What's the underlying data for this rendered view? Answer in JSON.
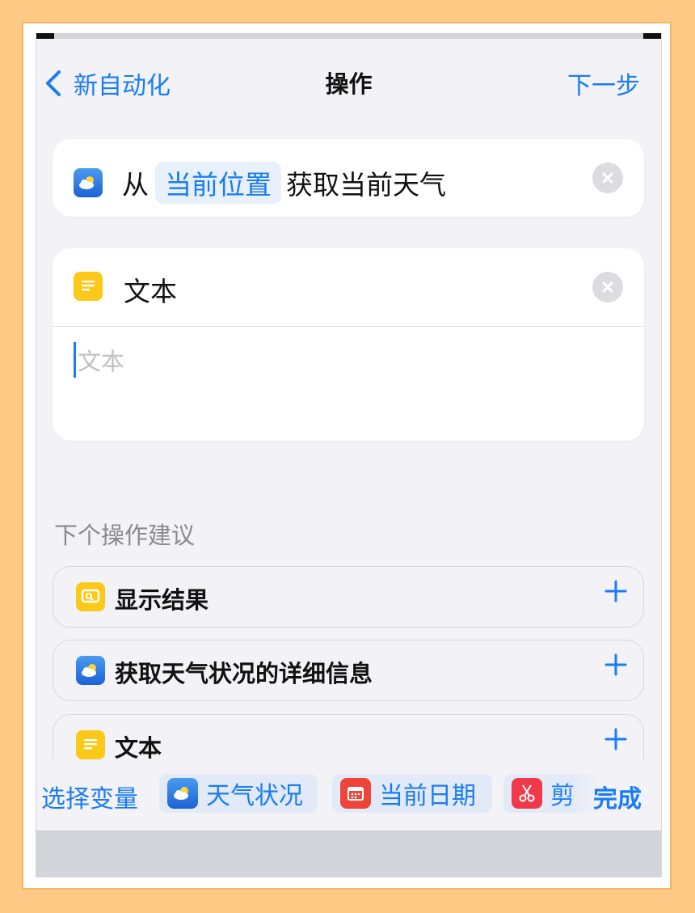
{
  "nav": {
    "back_label": "新自动化",
    "title": "操作",
    "next_label": "下一步"
  },
  "actions": {
    "weather": {
      "prefix": "从",
      "token": "当前位置",
      "suffix": "获取当前天气",
      "icon": "weather-icon"
    },
    "text": {
      "label": "文本",
      "placeholder": "文本",
      "icon": "text-icon"
    }
  },
  "suggestions": {
    "header": "下个操作建议",
    "items": [
      {
        "label": "显示结果",
        "icon": "show-result-icon"
      },
      {
        "label": "获取天气状况的详细信息",
        "icon": "weather-icon"
      },
      {
        "label": "文本",
        "icon": "text-icon"
      }
    ]
  },
  "variables": {
    "title": "选择变量",
    "chips": [
      {
        "label": "天气状况",
        "icon": "weather-icon"
      },
      {
        "label": "当前日期",
        "icon": "calendar-icon"
      },
      {
        "label": "剪",
        "icon": "scissors-icon"
      }
    ],
    "done_label": "完成"
  },
  "colors": {
    "accent": "#1a7cf5",
    "background": "#f2f2f7",
    "frame": "#fdc984"
  }
}
